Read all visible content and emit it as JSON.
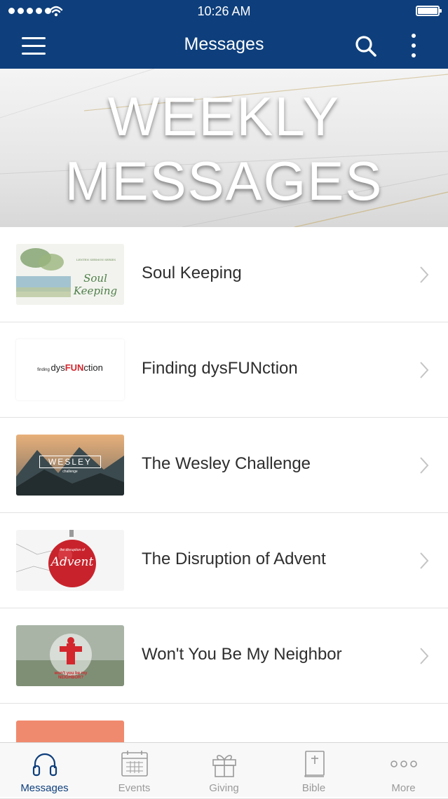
{
  "status_bar": {
    "time": "10:26 AM"
  },
  "nav": {
    "title": "Messages"
  },
  "banner": {
    "line1": "WEEKLY",
    "line2": "MESSAGES"
  },
  "messages": [
    {
      "title": "Soul Keeping",
      "thumb_text": "Soul Keeping",
      "thumb_caption": "LENTEN SERMON SERIES"
    },
    {
      "title": "Finding dysFUNction",
      "thumb_text_a": "finding ",
      "thumb_text_b": "dys",
      "thumb_text_c": "FUN",
      "thumb_text_d": "ction"
    },
    {
      "title": "The Wesley Challenge",
      "thumb_text": "WESLEY",
      "thumb_caption": "challenge"
    },
    {
      "title": "The Disruption of Advent",
      "thumb_text": "Advent",
      "thumb_caption": "the disruption of"
    },
    {
      "title": "Won't You Be My Neighbor",
      "thumb_text": "won't you be my NEIGHBOR?"
    }
  ],
  "tabs": [
    {
      "label": "Messages",
      "icon": "headphones-icon",
      "active": true
    },
    {
      "label": "Events",
      "icon": "calendar-icon",
      "active": false
    },
    {
      "label": "Giving",
      "icon": "gift-icon",
      "active": false
    },
    {
      "label": "Bible",
      "icon": "bible-icon",
      "active": false
    },
    {
      "label": "More",
      "icon": "ellipsis-icon",
      "active": false
    }
  ],
  "colors": {
    "brand": "#0e3f7c",
    "accent_red": "#d3262d",
    "tab_inactive": "#9a9a9a"
  }
}
